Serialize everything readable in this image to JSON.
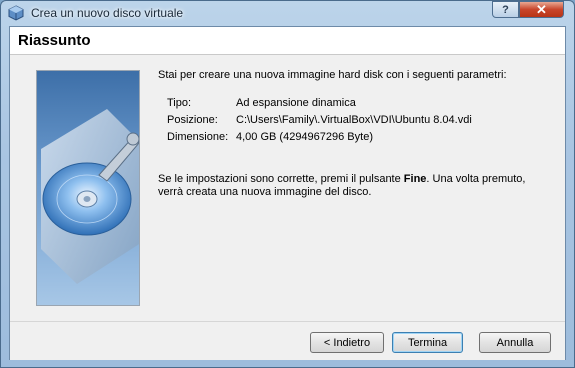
{
  "window": {
    "title": "Crea un nuovo disco virtuale",
    "help_label": "?",
    "close_label": "✕"
  },
  "page": {
    "heading": "Riassunto",
    "intro": "Stai per creare una nuova immagine hard disk con i seguenti parametri:",
    "params": [
      {
        "label": "Tipo:",
        "value": "Ad espansione dinamica"
      },
      {
        "label": "Posizione:",
        "value": "C:\\Users\\Family\\.VirtualBox\\VDI\\Ubuntu 8.04.vdi"
      },
      {
        "label": "Dimensione:",
        "value": "4,00 GB (4294967296 Byte)"
      }
    ],
    "final_before": "Se le impostazioni sono corrette, premi il pulsante ",
    "final_bold": "Fine",
    "final_after": ". Una volta premuto, verrà creata una nuova immagine del disco."
  },
  "buttons": {
    "back": "< Indietro",
    "finish": "Termina",
    "cancel": "Annulla"
  }
}
